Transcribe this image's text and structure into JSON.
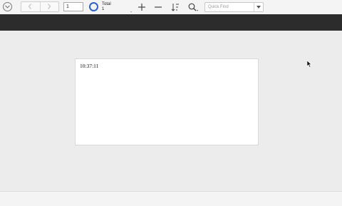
{
  "toolbar": {
    "record_number": "1",
    "total_label": "Total",
    "total_count": "1",
    "quick_find_placeholder": "Quick Find"
  },
  "layout_card": {
    "time_value": "10:37:11"
  },
  "icons": {
    "menu": "chevron-circle-icon",
    "back": "chevron-left-icon",
    "forward": "chevron-right-icon",
    "records": "pie-icon",
    "new_record": "plus-icon",
    "delete_record": "minus-icon",
    "sort": "sort-icon",
    "find": "magnifier-icon"
  },
  "colors": {
    "header_band": "#2c2c2c",
    "pie_accent": "#2f63c7"
  }
}
